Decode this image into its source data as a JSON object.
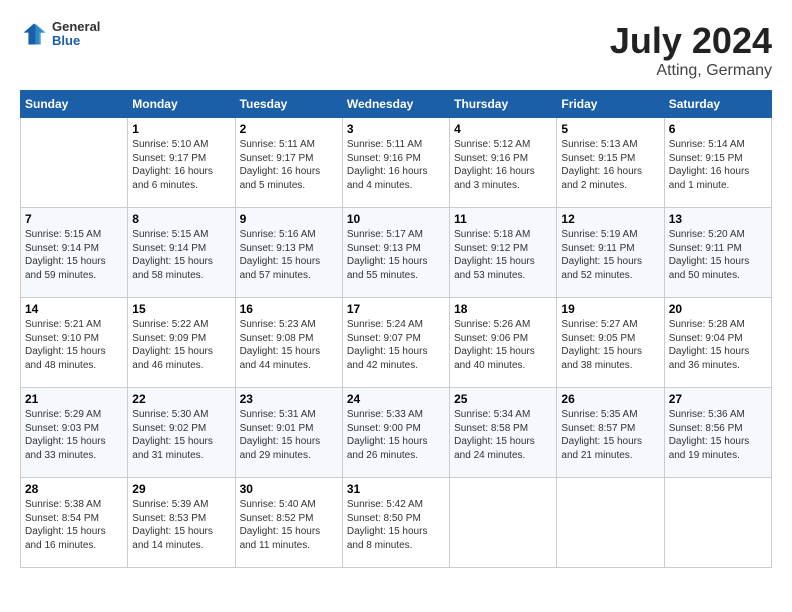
{
  "header": {
    "logo": {
      "general": "General",
      "blue": "Blue"
    },
    "title": "July 2024",
    "location": "Atting, Germany"
  },
  "columns": [
    "Sunday",
    "Monday",
    "Tuesday",
    "Wednesday",
    "Thursday",
    "Friday",
    "Saturday"
  ],
  "weeks": [
    [
      {
        "day": "",
        "empty": true
      },
      {
        "day": "1",
        "sunrise": "Sunrise: 5:10 AM",
        "sunset": "Sunset: 9:17 PM",
        "daylight": "Daylight: 16 hours and 6 minutes."
      },
      {
        "day": "2",
        "sunrise": "Sunrise: 5:11 AM",
        "sunset": "Sunset: 9:17 PM",
        "daylight": "Daylight: 16 hours and 5 minutes."
      },
      {
        "day": "3",
        "sunrise": "Sunrise: 5:11 AM",
        "sunset": "Sunset: 9:16 PM",
        "daylight": "Daylight: 16 hours and 4 minutes."
      },
      {
        "day": "4",
        "sunrise": "Sunrise: 5:12 AM",
        "sunset": "Sunset: 9:16 PM",
        "daylight": "Daylight: 16 hours and 3 minutes."
      },
      {
        "day": "5",
        "sunrise": "Sunrise: 5:13 AM",
        "sunset": "Sunset: 9:15 PM",
        "daylight": "Daylight: 16 hours and 2 minutes."
      },
      {
        "day": "6",
        "sunrise": "Sunrise: 5:14 AM",
        "sunset": "Sunset: 9:15 PM",
        "daylight": "Daylight: 16 hours and 1 minute."
      }
    ],
    [
      {
        "day": "7",
        "sunrise": "Sunrise: 5:15 AM",
        "sunset": "Sunset: 9:14 PM",
        "daylight": "Daylight: 15 hours and 59 minutes."
      },
      {
        "day": "8",
        "sunrise": "Sunrise: 5:15 AM",
        "sunset": "Sunset: 9:14 PM",
        "daylight": "Daylight: 15 hours and 58 minutes."
      },
      {
        "day": "9",
        "sunrise": "Sunrise: 5:16 AM",
        "sunset": "Sunset: 9:13 PM",
        "daylight": "Daylight: 15 hours and 57 minutes."
      },
      {
        "day": "10",
        "sunrise": "Sunrise: 5:17 AM",
        "sunset": "Sunset: 9:13 PM",
        "daylight": "Daylight: 15 hours and 55 minutes."
      },
      {
        "day": "11",
        "sunrise": "Sunrise: 5:18 AM",
        "sunset": "Sunset: 9:12 PM",
        "daylight": "Daylight: 15 hours and 53 minutes."
      },
      {
        "day": "12",
        "sunrise": "Sunrise: 5:19 AM",
        "sunset": "Sunset: 9:11 PM",
        "daylight": "Daylight: 15 hours and 52 minutes."
      },
      {
        "day": "13",
        "sunrise": "Sunrise: 5:20 AM",
        "sunset": "Sunset: 9:11 PM",
        "daylight": "Daylight: 15 hours and 50 minutes."
      }
    ],
    [
      {
        "day": "14",
        "sunrise": "Sunrise: 5:21 AM",
        "sunset": "Sunset: 9:10 PM",
        "daylight": "Daylight: 15 hours and 48 minutes."
      },
      {
        "day": "15",
        "sunrise": "Sunrise: 5:22 AM",
        "sunset": "Sunset: 9:09 PM",
        "daylight": "Daylight: 15 hours and 46 minutes."
      },
      {
        "day": "16",
        "sunrise": "Sunrise: 5:23 AM",
        "sunset": "Sunset: 9:08 PM",
        "daylight": "Daylight: 15 hours and 44 minutes."
      },
      {
        "day": "17",
        "sunrise": "Sunrise: 5:24 AM",
        "sunset": "Sunset: 9:07 PM",
        "daylight": "Daylight: 15 hours and 42 minutes."
      },
      {
        "day": "18",
        "sunrise": "Sunrise: 5:26 AM",
        "sunset": "Sunset: 9:06 PM",
        "daylight": "Daylight: 15 hours and 40 minutes."
      },
      {
        "day": "19",
        "sunrise": "Sunrise: 5:27 AM",
        "sunset": "Sunset: 9:05 PM",
        "daylight": "Daylight: 15 hours and 38 minutes."
      },
      {
        "day": "20",
        "sunrise": "Sunrise: 5:28 AM",
        "sunset": "Sunset: 9:04 PM",
        "daylight": "Daylight: 15 hours and 36 minutes."
      }
    ],
    [
      {
        "day": "21",
        "sunrise": "Sunrise: 5:29 AM",
        "sunset": "Sunset: 9:03 PM",
        "daylight": "Daylight: 15 hours and 33 minutes."
      },
      {
        "day": "22",
        "sunrise": "Sunrise: 5:30 AM",
        "sunset": "Sunset: 9:02 PM",
        "daylight": "Daylight: 15 hours and 31 minutes."
      },
      {
        "day": "23",
        "sunrise": "Sunrise: 5:31 AM",
        "sunset": "Sunset: 9:01 PM",
        "daylight": "Daylight: 15 hours and 29 minutes."
      },
      {
        "day": "24",
        "sunrise": "Sunrise: 5:33 AM",
        "sunset": "Sunset: 9:00 PM",
        "daylight": "Daylight: 15 hours and 26 minutes."
      },
      {
        "day": "25",
        "sunrise": "Sunrise: 5:34 AM",
        "sunset": "Sunset: 8:58 PM",
        "daylight": "Daylight: 15 hours and 24 minutes."
      },
      {
        "day": "26",
        "sunrise": "Sunrise: 5:35 AM",
        "sunset": "Sunset: 8:57 PM",
        "daylight": "Daylight: 15 hours and 21 minutes."
      },
      {
        "day": "27",
        "sunrise": "Sunrise: 5:36 AM",
        "sunset": "Sunset: 8:56 PM",
        "daylight": "Daylight: 15 hours and 19 minutes."
      }
    ],
    [
      {
        "day": "28",
        "sunrise": "Sunrise: 5:38 AM",
        "sunset": "Sunset: 8:54 PM",
        "daylight": "Daylight: 15 hours and 16 minutes."
      },
      {
        "day": "29",
        "sunrise": "Sunrise: 5:39 AM",
        "sunset": "Sunset: 8:53 PM",
        "daylight": "Daylight: 15 hours and 14 minutes."
      },
      {
        "day": "30",
        "sunrise": "Sunrise: 5:40 AM",
        "sunset": "Sunset: 8:52 PM",
        "daylight": "Daylight: 15 hours and 11 minutes."
      },
      {
        "day": "31",
        "sunrise": "Sunrise: 5:42 AM",
        "sunset": "Sunset: 8:50 PM",
        "daylight": "Daylight: 15 hours and 8 minutes."
      },
      {
        "day": "",
        "empty": true
      },
      {
        "day": "",
        "empty": true
      },
      {
        "day": "",
        "empty": true
      }
    ]
  ]
}
